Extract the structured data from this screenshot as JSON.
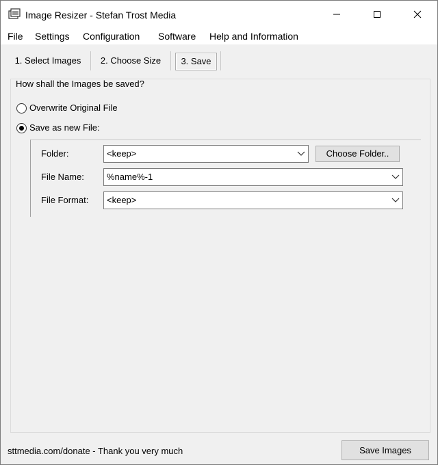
{
  "window": {
    "title": "Image Resizer - Stefan Trost Media"
  },
  "menu": {
    "items": [
      {
        "label": "File"
      },
      {
        "label": "Settings"
      },
      {
        "label": "Configuration"
      },
      {
        "label": "Software"
      },
      {
        "label": "Help and Information"
      }
    ]
  },
  "tabs": [
    {
      "label": "1. Select Images",
      "active": false
    },
    {
      "label": "2. Choose Size",
      "active": false
    },
    {
      "label": "3. Save",
      "active": true
    }
  ],
  "save": {
    "question": "How shall the Images be saved?",
    "options": [
      {
        "label": "Overwrite Original File",
        "selected": false
      },
      {
        "label": "Save as new File:",
        "selected": true
      }
    ],
    "folder": {
      "label": "Folder:",
      "value": "<keep>",
      "button": "Choose Folder.."
    },
    "file_name": {
      "label": "File Name:",
      "value": "%name%-1"
    },
    "file_format": {
      "label": "File Format:",
      "value": "<keep>"
    }
  },
  "footer": {
    "donate_text": "sttmedia.com/donate - Thank you very much",
    "save_button": "Save Images"
  },
  "colors": {
    "window_bg": "#f0f0f0",
    "titlebar_bg": "#ffffff",
    "button_bg": "#e1e1e1",
    "button_border": "#adadad"
  }
}
